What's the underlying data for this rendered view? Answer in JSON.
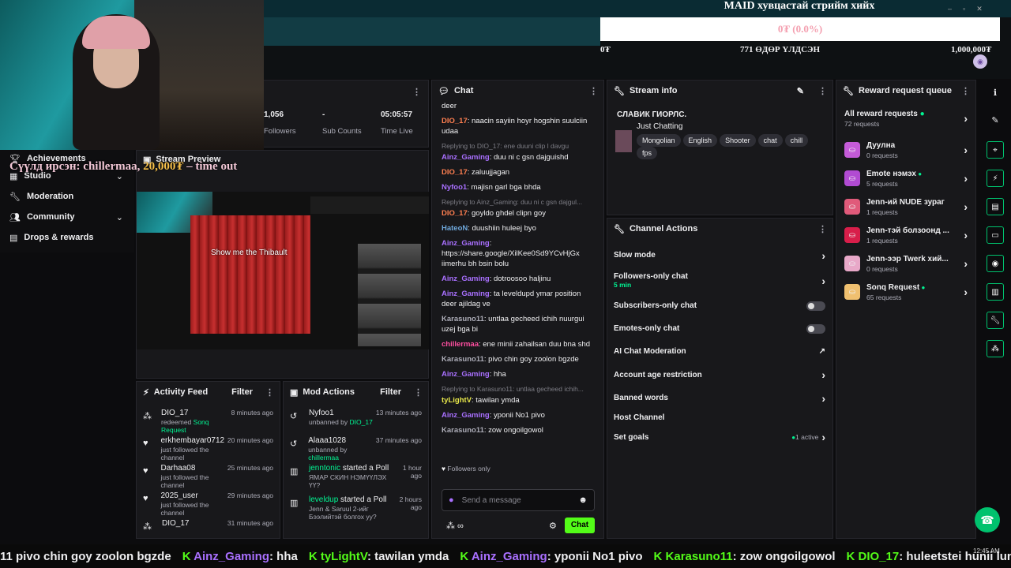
{
  "overlay": {
    "goal_title": "MAID хувцастай стрийм хийх",
    "goal_progress_text": "0₮ (0.0%)",
    "goal_progress_fraction": 0.0,
    "goal_min": "0₮",
    "goal_days_left": "771 ӨДӨР ҮЛДСЭН",
    "goal_max": "1,000,000₮",
    "donation_text": "Сүүлд ирсэн: chillermaa,",
    "donation_amount": "20,000₮",
    "donation_suffix": " – time out"
  },
  "stats": {
    "followers_value": "1,056",
    "followers_label": "Followers",
    "subs_value": "-",
    "subs_label": "Sub Counts",
    "time_value": "05:05:57",
    "time_label": "Time Live"
  },
  "nav": {
    "items": [
      {
        "label": "Achievements"
      },
      {
        "label": "Studio"
      },
      {
        "label": "Moderation"
      },
      {
        "label": "Community"
      },
      {
        "label": "Drops & rewards"
      }
    ]
  },
  "preview": {
    "title": "Stream Preview",
    "overlay_text": "Show me the Thibault"
  },
  "chat": {
    "title": "Chat",
    "messages": [
      {
        "reply": "",
        "user": "",
        "color": "",
        "text": "deer"
      },
      {
        "reply": "",
        "user": "DIO_17",
        "color": "#ff7f50",
        "text": ": naacin sayiin hoyr hogshin suulciin udaa"
      },
      {
        "reply": "Replying to DIO_17: ene duuni clip l davgu",
        "user": "Ainz_Gaming",
        "color": "#a970ff",
        "text": ": duu ni c gsn dajguishd"
      },
      {
        "reply": "",
        "user": "DIO_17",
        "color": "#ff7f50",
        "text": ": zaluujjagan"
      },
      {
        "reply": "",
        "user": "Nyfoo1",
        "color": "#a970ff",
        "text": ": majisn garl bga bhda"
      },
      {
        "reply": "Replying to Ainz_Gaming: duu ni c gsn dajgul...",
        "user": "DIO_17",
        "color": "#ff7f50",
        "text": ": goyldo ghdel clipn goy"
      },
      {
        "reply": "",
        "user": "HateoN",
        "color": "#6fa8dc",
        "text": ": duushiin huleej byo"
      },
      {
        "reply": "",
        "user": "Ainz_Gaming",
        "color": "#a970ff",
        "text": ": https://share.google/XilKee0Sd9YCvHjGx iimerhu bh bsin bolu"
      },
      {
        "reply": "",
        "user": "Ainz_Gaming",
        "color": "#a970ff",
        "text": ": dotroosoo haljinu"
      },
      {
        "reply": "",
        "user": "Ainz_Gaming",
        "color": "#a970ff",
        "text": ": ta leveldupd ymar position deer ajildag ve"
      },
      {
        "reply": "",
        "user": "Karasuno11",
        "color": "#adadb8",
        "text": ": untlaa gecheed ichih nuurgui uzej bga bi"
      },
      {
        "reply": "",
        "user": "chillermaa",
        "color": "#ff4fa0",
        "text": ": ene minii zahailsan duu bna shd"
      },
      {
        "reply": "",
        "user": "Karasuno11",
        "color": "#adadb8",
        "text": ": pivo chin goy zoolon bgzde"
      },
      {
        "reply": "",
        "user": "Ainz_Gaming",
        "color": "#a970ff",
        "text": ": hha"
      },
      {
        "reply": "Replying to Karasuno11: untlaa gecheed ichih...",
        "user": "tyLightV",
        "color": "#e8e84a",
        "text": ": tawilan ymda"
      },
      {
        "reply": "",
        "user": "Ainz_Gaming",
        "color": "#a970ff",
        "text": ": yponii No1 pivo"
      },
      {
        "reply": "",
        "user": "Karasuno11",
        "color": "#adadb8",
        "text": ": zow ongoilgowol"
      }
    ],
    "followers_only": "Followers only",
    "input_placeholder": "Send a message",
    "send_label": "Chat"
  },
  "stream_info": {
    "title": "Stream info",
    "stream_title": "СЛАВИК ГИОРЛС.",
    "category": "Just Chatting",
    "tags": [
      "Mongolian",
      "English",
      "Shooter",
      "chat",
      "chill",
      "fps"
    ]
  },
  "channel_actions": {
    "title": "Channel Actions",
    "items": [
      {
        "label": "Slow mode",
        "sub": "",
        "control": "chevron"
      },
      {
        "label": "Followers-only chat",
        "sub": "5 min",
        "control": "chevron"
      },
      {
        "label": "Subscribers-only chat",
        "sub": "",
        "control": "toggle"
      },
      {
        "label": "Emotes-only chat",
        "sub": "",
        "control": "toggle"
      },
      {
        "label": "AI Chat Moderation",
        "sub": "",
        "control": "external"
      },
      {
        "label": "Account age restriction",
        "sub": "",
        "control": "chevron"
      },
      {
        "label": "Banned words",
        "sub": "",
        "control": "chevron"
      },
      {
        "label": "Host Channel",
        "sub": "",
        "control": "none"
      },
      {
        "label": "Set goals",
        "sub": "",
        "control": "active",
        "status": "1 active"
      }
    ]
  },
  "rewards": {
    "title": "Reward request queue",
    "all_label": "All reward requests",
    "all_count": "72 requests",
    "items": [
      {
        "name": "Дуулна",
        "count": "0 requests",
        "color": "#c45bd8",
        "dot": false
      },
      {
        "name": "Emote нэмэх",
        "count": "5 requests",
        "color": "#b14bd2",
        "dot": true
      },
      {
        "name": "Jenn-ий NUDE зураг",
        "count": "1 requests",
        "color": "#e05a7a",
        "dot": false
      },
      {
        "name": "Jenn-тэй болзоонд ...",
        "count": "1 requests",
        "color": "#d81e4a",
        "dot": false
      },
      {
        "name": "Jenn-ээр Twerk хий...",
        "count": "0 requests",
        "color": "#e8a8c8",
        "dot": false
      },
      {
        "name": "Sonq Request",
        "count": "65 requests",
        "color": "#f0c070",
        "dot": true
      }
    ]
  },
  "activity": {
    "title": "Activity Feed",
    "filter": "Filter",
    "items": [
      {
        "user": "DIO_17",
        "action": "redeemed",
        "extra": "Sonq Request",
        "time": "8 minutes ago",
        "icon": "reward-icon"
      },
      {
        "user": "erkhembayar0712",
        "action": "just followed the channel",
        "extra": "",
        "time": "20 minutes ago",
        "icon": "heart-icon"
      },
      {
        "user": "Darhaa08",
        "action": "just followed the channel",
        "extra": "",
        "time": "25 minutes ago",
        "icon": "heart-icon"
      },
      {
        "user": "2025_user",
        "action": "just followed the channel",
        "extra": "",
        "time": "29 minutes ago",
        "icon": "heart-icon"
      },
      {
        "user": "DIO_17",
        "action": "",
        "extra": "",
        "time": "31 minutes ago",
        "icon": "reward-icon"
      }
    ]
  },
  "mod": {
    "title": "Mod Actions",
    "filter": "Filter",
    "items": [
      {
        "user": "Nyfoo1",
        "action": "unbanned by",
        "by": "DIO_17",
        "time": "13 minutes ago"
      },
      {
        "user": "Alaaa1028",
        "action": "unbanned by",
        "by": "chillermaa",
        "time": "37 minutes ago"
      },
      {
        "user": "jenntonic",
        "action": "started a Poll",
        "by": "ЯМАР СКИН НЭМҮҮЛЭХ ҮҮ?",
        "time": "1 hour ago"
      },
      {
        "user": "leveldup",
        "action": "started a Poll",
        "by": "Jenn & Saruul 2-ийг Бээлийтэй болгох уу?",
        "time": "2 hours ago"
      }
    ]
  },
  "ticker": {
    "items": [
      {
        "user": "",
        "text": "11 pivo chin goy zoolon bgzde"
      },
      {
        "user": "Ainz_Gaming",
        "text": ": hha"
      },
      {
        "user": "tyLightV",
        "text": ": tawilan ymda"
      },
      {
        "user": "Ainz_Gaming",
        "text": ": yponii No1 pivo"
      },
      {
        "user": "Karasuno11",
        "text": ": zow ongoilgowol"
      },
      {
        "user": "DIO_17",
        "text": ": huleetstei hunii lunch"
      }
    ],
    "clock": "12:45 AM"
  },
  "colors": {
    "accent": "#53fc18",
    "panel": "#18181b",
    "bg": "#0c0c0e"
  }
}
